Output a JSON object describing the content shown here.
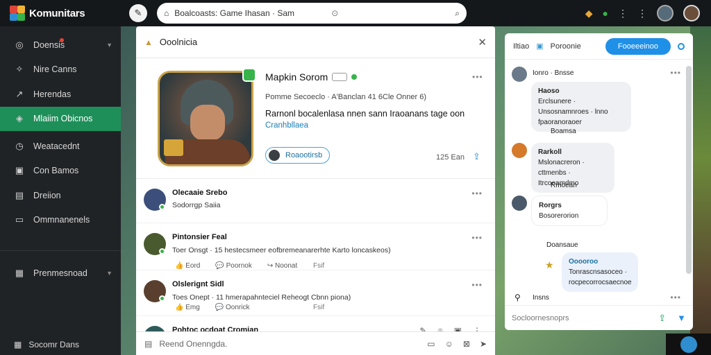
{
  "app": {
    "brand": "Komunitars"
  },
  "colors": {
    "accent": "#1f8f5a",
    "link": "#1a7fb5",
    "cta": "#1e90e8",
    "sidebar": "#202326",
    "topbar": "#15181b"
  },
  "search": {
    "text": "Boalcoasts: Game Ihasan · Sam",
    "icon": "search-icon"
  },
  "sidebar": {
    "items": [
      {
        "label": "Doensis",
        "icon": "home-icon"
      },
      {
        "label": "Nire Canns",
        "icon": "pin-icon"
      },
      {
        "label": "Herendas",
        "icon": "trending-icon"
      },
      {
        "label": "Mlaiim Obicnos",
        "icon": "tag-icon"
      },
      {
        "label": "Weatacednt",
        "icon": "clock-icon"
      },
      {
        "label": "Con Bamos",
        "icon": "calendar-icon"
      },
      {
        "label": "Dreiion",
        "icon": "chart-icon"
      },
      {
        "label": "Ommnanenels",
        "icon": "folder-icon"
      },
      {
        "label": "Prenmesnoad",
        "icon": "gamepad-icon"
      }
    ],
    "footer": "Socomr Dans"
  },
  "main": {
    "title": "Ooolnicia",
    "profile": {
      "name": "Mapkin Sorom",
      "stats": "Pomme Secoeclo · A'Banclan 41 6Cle Onner 6)",
      "bio": "Rarnonl bocalenlasa nnen sann Iraoanans tage oon",
      "link": "Cranhbllaea",
      "button": "Roaootirsb",
      "count": "125 Ean"
    },
    "posts": [
      {
        "name": "Olecaaie Srebo",
        "time": "",
        "text": "Sodorrgp Saiia",
        "actions": []
      },
      {
        "name": "Pintonsier Feal",
        "time": "",
        "text": "Toer Onsgt · 15 hestecsmeer eofbremeanarerhte Karto loncaskeos)",
        "actions": [
          "Eord",
          "Poornok",
          "Noonat"
        ],
        "sub": "Fsif"
      },
      {
        "name": "Olslerignt Sidl",
        "time": "",
        "text": "Toes Onept · 11 hmerapahnteciel Reheogt Cbnn piona)",
        "actions": [
          "Emg",
          "Oonrick"
        ],
        "sub": "Fsif"
      },
      {
        "name": "Pohtoc ocdoat Cromian",
        "time": "",
        "text": "",
        "actions": []
      }
    ],
    "composer_placeholder": "Reend Onenngda."
  },
  "chat": {
    "tab1": "Iltiao",
    "tab2": "Poroonie",
    "cta": "Fooeeeinoo",
    "messages": [
      {
        "name": "Ionro · Bnsse",
        "bubble_title": "Haoso",
        "bubble_text": "Erclsunere · Unsosnamnroes · lnno fpaoranoraoer",
        "reply": "Boamsa"
      },
      {
        "name": "Rarkoll",
        "bubble_text": "Mslonacreron · cttmenbs · Itrcoeamdmo",
        "reply": "Rmoean"
      },
      {
        "name": "Rorgrs",
        "bubble_text": "Bosorerorion",
        "reply": "Doansaue"
      },
      {
        "name": "Ooooroo",
        "bubble_text": "Tonrascnsasoceo · rocpecorrocsaecnoe"
      },
      {
        "name": "Insns"
      }
    ],
    "input_placeholder": "Socloornesnoprs"
  }
}
